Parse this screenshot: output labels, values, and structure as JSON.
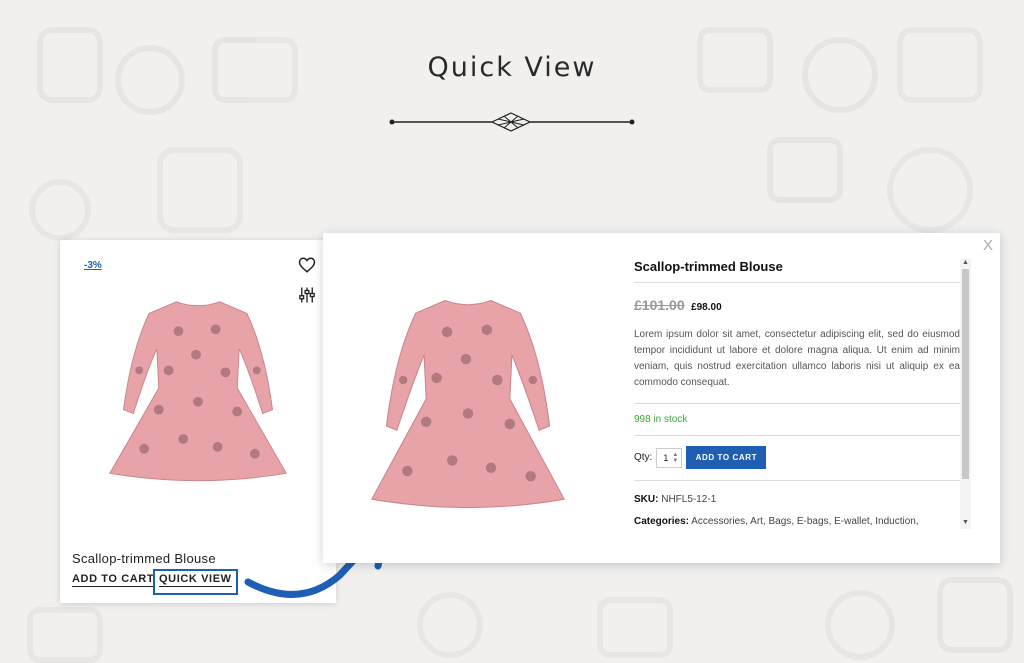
{
  "page": {
    "heading": "Quick View"
  },
  "card": {
    "badge": "-3%",
    "title": "Scallop-trimmed Blouse",
    "add_to_cart": "ADD TO CART",
    "quick_view": "QUICK VIEW"
  },
  "modal": {
    "close": "X",
    "title": "Scallop-trimmed Blouse",
    "old_price": "£101.00",
    "new_price": "£98.00",
    "description": "Lorem ipsum dolor sit amet, consectetur adipiscing elit, sed do eiusmod tempor incididunt ut labore et dolore magna aliqua. Ut enim ad minim veniam, quis nostrud exercitation ullamco laboris nisi ut aliquip ex ea commodo consequat.",
    "stock": "998 in stock",
    "qty_label": "Qty:",
    "qty_value": "1",
    "add_to_cart": "ADD TO CART",
    "sku_label": "SKU:",
    "sku_value": "NHFL5-12-1",
    "categories_label": "Categories:",
    "categories": [
      "Accessories",
      "Art",
      "Bags",
      "E-bags",
      "E-wallet",
      "Induction"
    ]
  },
  "colors": {
    "accent": "#1e5fb4",
    "stock": "#3aaa35",
    "dress": "#e8a3a8"
  },
  "icons": [
    "heart-icon",
    "compare-icon",
    "close-icon",
    "arrow-icon",
    "divider-ornament-icon"
  ]
}
